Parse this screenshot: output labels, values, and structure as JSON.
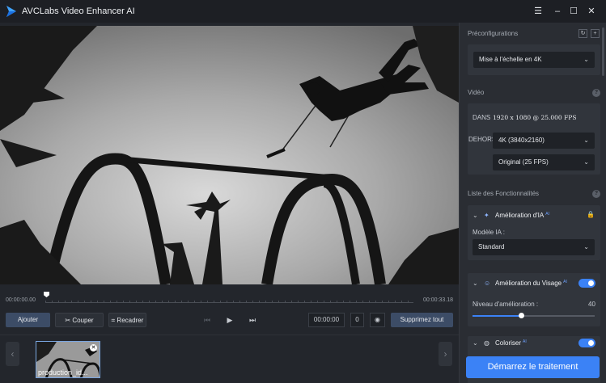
{
  "app": {
    "title": "AVCLabs Video Enhancer AI"
  },
  "window": {
    "menu_icon": "hamburger-menu-icon",
    "minimize_icon": "minimize-icon",
    "maximize_icon": "maximize-icon",
    "close_icon": "close-icon"
  },
  "player": {
    "time_start": "00:00:00.00",
    "time_end": "00:00:33.18",
    "progress": 0.0
  },
  "toolbar": {
    "add_label": "Ajouter",
    "cut_label": "Couper",
    "crop_label": "Recadrer",
    "time_value": "00:00:00",
    "frame_value": "0",
    "remove_all_label": "Supprimez tout"
  },
  "filelist": {
    "items": [
      {
        "name": "production_id..."
      }
    ]
  },
  "presets": {
    "title": "Préconfigurations",
    "selected": "Mise à l'échelle en 4K"
  },
  "video": {
    "title": "Vidéo",
    "in_label": "DANS",
    "in_value": "1920 x 1080 @ 25.000 FPS",
    "out_label": "DEHORS",
    "resolution": "4K (3840x2160)",
    "framerate": "Original (25 FPS)"
  },
  "features": {
    "title": "Liste des Fonctionnalités",
    "ai_badge": "AI",
    "ia": {
      "title": "Amélioration d'IA",
      "model_label": "Modèle IA :",
      "model": "Standard"
    },
    "face": {
      "title": "Amélioration du Visage",
      "enabled": true,
      "level_label": "Niveau d'amélioration :",
      "level": "40",
      "level_fraction": 0.4
    },
    "colorize": {
      "title": "Coloriser",
      "enabled": true
    }
  },
  "start_button": {
    "label": "Démarrez le traitement"
  },
  "colors": {
    "accent": "#3b82f6",
    "panel": "#2a2d33",
    "background": "#1b1d22"
  }
}
